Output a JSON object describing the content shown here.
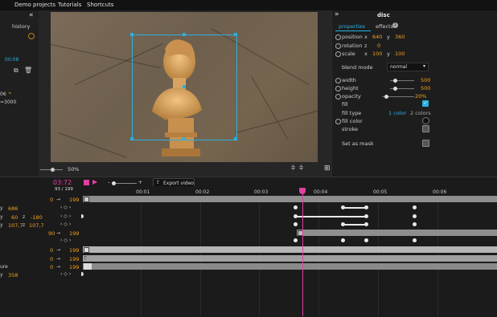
{
  "menu": {
    "items": [
      "Demo projects",
      "Tutorials",
      "Shortcuts"
    ]
  },
  "left_panel": {
    "collapse": "«",
    "history_label": "history",
    "value_08": "00:08",
    "line_06": "06",
    "line_3000": "=3000"
  },
  "canvas": {
    "zoom": "50%"
  },
  "right_panel": {
    "collapse": "»",
    "object_name": "disc",
    "tab_properties": "properties",
    "tab_effects": "effects",
    "position_label": "position",
    "pos_x_lbl": "x",
    "pos_x": "640",
    "pos_y_lbl": "y",
    "pos_y": "360",
    "rotation_label": "rotation",
    "rot_z_lbl": "z",
    "rot_z": "0",
    "scale_label": "scale",
    "scale_x_lbl": "x",
    "scale_x": "100",
    "scale_y_lbl": "y",
    "scale_y": "100",
    "blend_mode_label": "blend mode",
    "blend_mode_value": "normal",
    "width_label": "width",
    "width_value": "500",
    "height_label": "height",
    "height_value": "500",
    "opacity_label": "opacity",
    "opacity_value": "20%",
    "fill_label": "fill",
    "fill_type_label": "fill type",
    "fill_type_1": "1 color",
    "fill_type_2": "2 colors",
    "fill_color_label": "fill color",
    "stroke_label": "stroke",
    "set_as_mask_label": "Set as mask"
  },
  "timeline": {
    "time": "03:72",
    "frames": "93 / 199",
    "export_label": "Export video",
    "ticks": [
      "00:01",
      "00:02",
      "00:03",
      "00:04",
      "00:05",
      "00:06"
    ],
    "rows": [
      {
        "start": "0",
        "end": "199"
      },
      {
        "label": "y",
        "v1": "686"
      },
      {
        "label": "y",
        "v1": "60",
        "v2lbl": "z",
        "v2": "-180"
      },
      {
        "label": "y",
        "v1": "107,7",
        "v2lbl": "z",
        "v2": "107,7"
      },
      {
        "start": "90",
        "end": "199"
      },
      {
        "start": "0",
        "end": "199"
      },
      {
        "start": "0",
        "end": "199"
      },
      {
        "label": "ure",
        "start": "0",
        "end": "199"
      },
      {
        "label": "y",
        "v1": "358"
      }
    ]
  },
  "colors": {
    "accent": "#f0a020",
    "playhead": "#e040a0",
    "selection": "#2ab0e0"
  }
}
